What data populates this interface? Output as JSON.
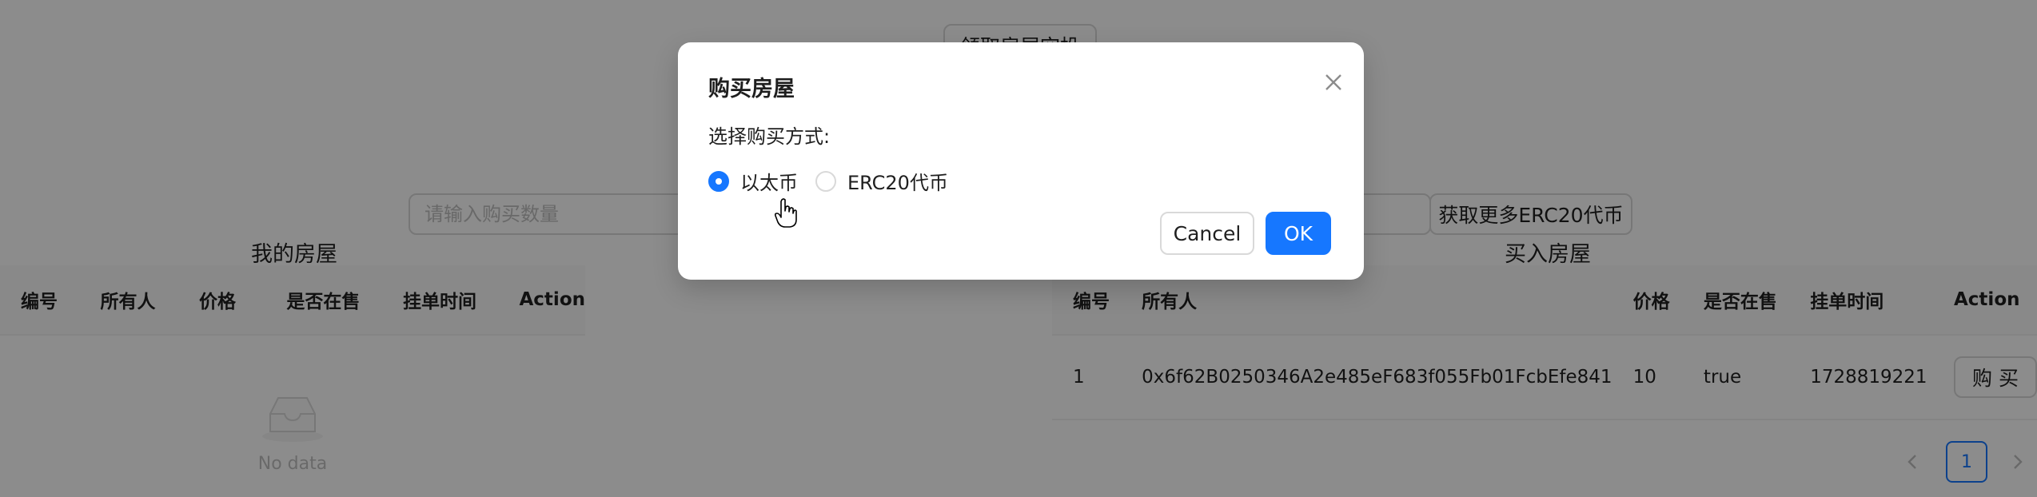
{
  "background": {
    "top_button_label": "领取房屋空投",
    "quantity_input_placeholder": "请输入购买数量",
    "get_more_erc20_label": "获取更多ERC20代币",
    "my_houses": {
      "title": "我的房屋",
      "columns": [
        "编号",
        "所有人",
        "价格",
        "是否在售",
        "挂单时间",
        "Action"
      ],
      "empty_text": "No data"
    },
    "buy_houses": {
      "title": "买入房屋",
      "columns": [
        "编号",
        "所有人",
        "价格",
        "是否在售",
        "挂单时间",
        "Action"
      ],
      "rows": [
        {
          "id": "1",
          "owner": "0x6f62B0250346A2e485eF683f055Fb01FcbEfe841",
          "price": "10",
          "on_sale": "true",
          "listed_time": "1728819221",
          "action_label": "购 买"
        }
      ],
      "pagination": {
        "prev_icon": "left-chevron-icon",
        "current_page": "1",
        "next_icon": "right-chevron-icon"
      }
    }
  },
  "modal": {
    "title": "购买房屋",
    "prompt": "选择购买方式:",
    "options": [
      {
        "label": "以太币",
        "selected": true
      },
      {
        "label": "ERC20代币",
        "selected": false
      }
    ],
    "cancel_label": "Cancel",
    "ok_label": "OK",
    "close_icon": "close-icon"
  },
  "colors": {
    "primary": "#1677ff",
    "mask": "rgba(0,0,0,0.45)"
  }
}
